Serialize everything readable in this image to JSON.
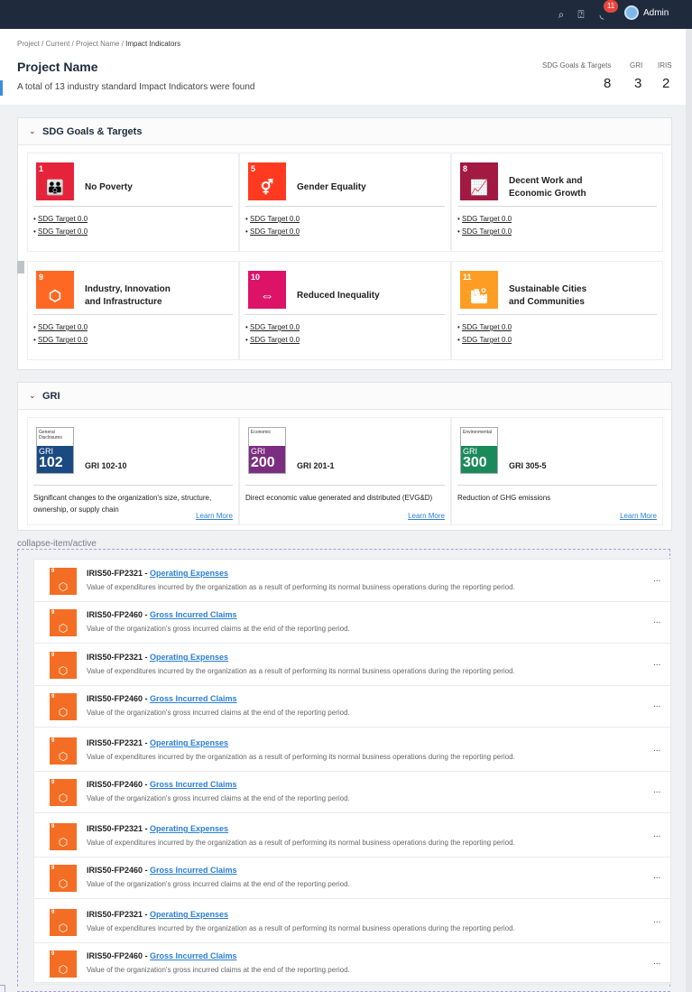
{
  "topbar": {
    "search_icon": "🔍",
    "help_icon": "?",
    "bell_icon": "🔔",
    "notification_count": "11",
    "user_name": "Admin"
  },
  "breadcrumb": {
    "items": [
      "Project",
      "Current",
      "Project Name"
    ],
    "sep": "/",
    "current": "Impact Indicators"
  },
  "page": {
    "title": "Project Name",
    "subtitle": "A total of 13 industry standard Impact Indicators were found"
  },
  "stats": [
    {
      "label": "SDG Goals & Targets",
      "value": "8"
    },
    {
      "label": "GRI",
      "value": "3"
    },
    {
      "label": "IRIS",
      "value": "2"
    }
  ],
  "sdg": {
    "title": "SDG Goals & Targets",
    "cards": [
      {
        "num": "1",
        "label": "NO POVERTY",
        "name_lines": [
          "No Poverty"
        ],
        "color": "#e5243b",
        "icon": "family-icon",
        "glyph": "👪",
        "targets": [
          "SDG Target 0.0",
          "SDG Target 0.0"
        ]
      },
      {
        "num": "5",
        "label": "GENDER EQUALITY",
        "name_lines": [
          "Gender Equality"
        ],
        "color": "#ff3a21",
        "icon": "gender-icon",
        "glyph": "⚥",
        "targets": [
          "SDG Target 0.0",
          "SDG Target 0.0"
        ]
      },
      {
        "num": "8",
        "label": "DECENT WORK AND ECONOMIC GROWTH",
        "name_lines": [
          "Decent Work and",
          "Economic Growth"
        ],
        "color": "#a21942",
        "icon": "growth-chart-icon",
        "glyph": "📈",
        "targets": [
          "SDG Target 0.0",
          "SDG Target 0.0"
        ]
      },
      {
        "num": "9",
        "label": "INDUSTRY, INNOVATION AND INFRASTRUCTURE",
        "name_lines": [
          "Industry, Innovation",
          "and Infrastructure"
        ],
        "color": "#fd6925",
        "icon": "cubes-icon",
        "glyph": "⬡",
        "targets": [
          "SDG Target 0.0",
          "SDG Target 0.0"
        ]
      },
      {
        "num": "10",
        "label": "REDUCED INEQUALITIES",
        "name_lines": [
          "Reduced Inequality"
        ],
        "color": "#dd1367",
        "icon": "equality-icon",
        "glyph": "⇔",
        "targets": [
          "SDG Target 0.0",
          "SDG Target 0.0"
        ]
      },
      {
        "num": "11",
        "label": "SUSTAINABLE CITIES AND COMMUNITIES",
        "name_lines": [
          "Sustainable Cities",
          "and Communities"
        ],
        "color": "#fd9d24",
        "icon": "city-icon",
        "glyph": "🏙",
        "targets": [
          "SDG Target 0.0",
          "SDG Target 0.0"
        ]
      }
    ]
  },
  "gri": {
    "title": "GRI",
    "cards": [
      {
        "category": "General Disclosures",
        "series": "102",
        "color": "#1a4a82",
        "code": "GRI 102-10",
        "desc": "Significant changes to the organization's size, structure, ownership, or supply chain",
        "link": "Learn More"
      },
      {
        "category": "Economic",
        "series": "200",
        "color": "#7b2d82",
        "code": "GRI 201-1",
        "desc": "Direct economic value generated and distributed (EVG&D)",
        "link": "Learn More"
      },
      {
        "category": "Environmental",
        "series": "300",
        "color": "#1b8a5a",
        "code": "GRI 305-5",
        "desc": "Reduction of GHG emissions",
        "link": "Learn More"
      }
    ]
  },
  "collapse_label": "collapse-item/active",
  "iris": {
    "rows": [
      {
        "code": "IRIS50-FP2321 - ",
        "name": "Operating Expenses",
        "desc": "Value of expenditures incurred by the organization as a result of performing its normal business operations during the reporting period.",
        "more": "..."
      },
      {
        "code": "IRIS50-FP2460 - ",
        "name": "Gross Incurred Claims",
        "desc": "Value of the organization's gross incurred claims at the end of the reporting period.",
        "more": "..."
      },
      {
        "code": "IRIS50-FP2321 - ",
        "name": "Operating Expenses",
        "desc": "Value of expenditures incurred by the organization as a result of performing its normal business operations during the reporting period.",
        "more": "..."
      },
      {
        "code": "IRIS50-FP2460 - ",
        "name": "Gross Incurred Claims",
        "desc": "Value of the organization's gross incurred claims at the end of the reporting period.",
        "more": "..."
      },
      {
        "code": "IRIS50-FP2321 - ",
        "name": "Operating Expenses",
        "desc": "Value of expenditures incurred by the organization as a result of performing its normal business operations during the reporting period.",
        "more": "..."
      },
      {
        "code": "IRIS50-FP2460 - ",
        "name": "Gross Incurred Claims",
        "desc": "Value of the organization's gross incurred claims at the end of the reporting period.",
        "more": "..."
      },
      {
        "code": "IRIS50-FP2321 - ",
        "name": "Operating Expenses",
        "desc": "Value of expenditures incurred by the organization as a result of performing its normal business operations during the reporting period.",
        "more": "..."
      },
      {
        "code": "IRIS50-FP2460 - ",
        "name": "Gross Incurred Claims",
        "desc": "Value of the organization's gross incurred claims at the end of the reporting period.",
        "more": "..."
      },
      {
        "code": "IRIS50-FP2321 - ",
        "name": "Operating Expenses",
        "desc": "Value of expenditures incurred by the organization as a result of performing its normal business operations during the reporting period.",
        "more": "..."
      },
      {
        "code": "IRIS50-FP2460 - ",
        "name": "Gross Incurred Claims",
        "desc": "Value of the organization's gross incurred claims at the end of the reporting period.",
        "more": "..."
      }
    ],
    "icon": {
      "num": "9",
      "glyph": "⬡",
      "color": "#f36e24"
    }
  }
}
